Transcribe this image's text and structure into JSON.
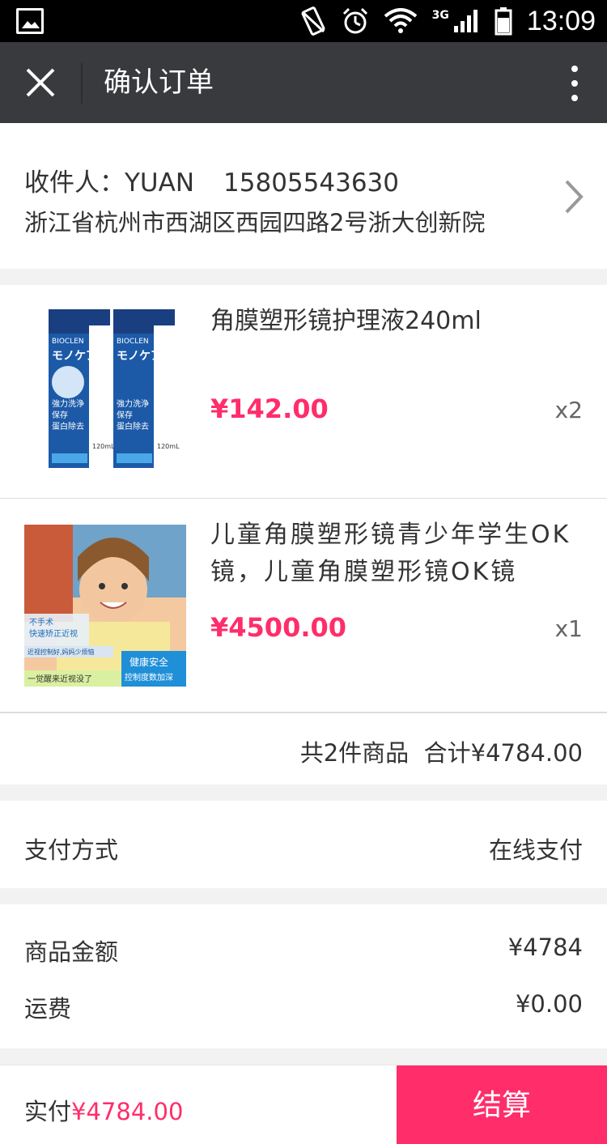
{
  "status_bar": {
    "time": "13:09",
    "network": "3G"
  },
  "title_bar": {
    "title": "确认订单"
  },
  "address": {
    "recipient_label": "收件人：YUAN",
    "phone": "15805543630",
    "full_address": "浙江省杭州市西湖区西园四路2号浙大创新院"
  },
  "goods": [
    {
      "title": "角膜塑形镜护理液240ml",
      "price": "¥142.00",
      "qty": "x2",
      "image_texts": [
        "BIOCLEN",
        "モノケア",
        "強力洗浄",
        "保存",
        "蛋白除去",
        "120mL"
      ]
    },
    {
      "title": "儿童角膜塑形镜青少年学生OK镜，儿童角膜塑形镜OK镜",
      "price": "¥4500.00",
      "qty": "x1",
      "image_texts": [
        "不手术",
        "快速矫正近视",
        "近视控制好,妈妈少烦恼",
        "一觉醒来近视没了",
        "健康安全",
        "控制度数加深"
      ]
    }
  ],
  "summary": {
    "text": "共2件商品  合计¥4784.00"
  },
  "payment": {
    "label": "支付方式",
    "value": "在线支付"
  },
  "amounts": {
    "goods_label": "商品金额",
    "goods_value": "¥4784",
    "shipping_label": "运费",
    "shipping_value": "¥0.00"
  },
  "bottom": {
    "total_label": "实付",
    "total_value": "¥4784.00",
    "checkout_label": "结算"
  },
  "colors": {
    "accent": "#ff2d6a",
    "titlebar": "#393a3e"
  }
}
